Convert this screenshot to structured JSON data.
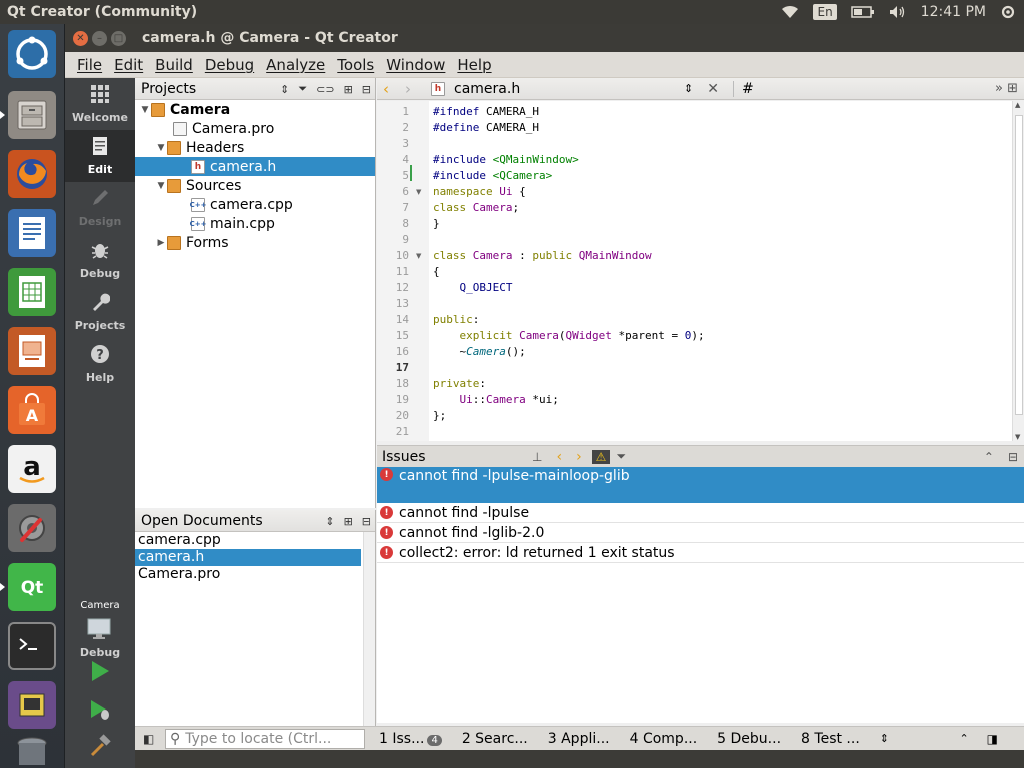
{
  "top_panel": {
    "title": "Qt Creator (Community)",
    "language": "En",
    "clock": "12:41 PM"
  },
  "launcher": {
    "items": [
      "ubuntu-dash",
      "files",
      "firefox",
      "libreoffice-writer",
      "libreoffice-calc",
      "libreoffice-impress",
      "ubuntu-software",
      "amazon",
      "system-settings",
      "qt-creator",
      "terminal",
      "photo-viewer",
      "trash"
    ]
  },
  "window": {
    "title": "camera.h @ Camera - Qt Creator"
  },
  "menu": [
    "File",
    "Edit",
    "Build",
    "Debug",
    "Analyze",
    "Tools",
    "Window",
    "Help"
  ],
  "modes": [
    {
      "label": "Welcome",
      "icon": "grid-icon",
      "state": "normal"
    },
    {
      "label": "Edit",
      "icon": "document-icon",
      "state": "active"
    },
    {
      "label": "Design",
      "icon": "pencil-icon",
      "state": "disabled"
    },
    {
      "label": "Debug",
      "icon": "bug-icon",
      "state": "normal"
    },
    {
      "label": "Projects",
      "icon": "wrench-icon",
      "state": "normal"
    },
    {
      "label": "Help",
      "icon": "question-icon",
      "state": "normal"
    }
  ],
  "kit": {
    "project": "Camera",
    "config": "Debug"
  },
  "projects_pane": {
    "title": "Projects",
    "tree": [
      {
        "label": "Camera",
        "depth": 0,
        "arrow": "▼",
        "icon": "project",
        "bold": true,
        "selected": false
      },
      {
        "label": "Camera.pro",
        "depth": 1,
        "arrow": "",
        "icon": "project",
        "bold": false,
        "selected": false
      },
      {
        "label": "Headers",
        "depth": 1,
        "arrow": "▼",
        "icon": "folder-h",
        "bold": false,
        "selected": false
      },
      {
        "label": "camera.h",
        "depth": 2,
        "arrow": "",
        "icon": "h",
        "bold": false,
        "selected": true
      },
      {
        "label": "Sources",
        "depth": 1,
        "arrow": "▼",
        "icon": "folder-cpp",
        "bold": false,
        "selected": false
      },
      {
        "label": "camera.cpp",
        "depth": 2,
        "arrow": "",
        "icon": "cpp",
        "bold": false,
        "selected": false
      },
      {
        "label": "main.cpp",
        "depth": 2,
        "arrow": "",
        "icon": "cpp",
        "bold": false,
        "selected": false
      },
      {
        "label": "Forms",
        "depth": 1,
        "arrow": "▶",
        "icon": "folder",
        "bold": false,
        "selected": false
      }
    ]
  },
  "open_documents": {
    "title": "Open Documents",
    "items": [
      {
        "label": "camera.cpp",
        "selected": false
      },
      {
        "label": "camera.h",
        "selected": true
      },
      {
        "label": "Camera.pro",
        "selected": false
      }
    ]
  },
  "editor": {
    "file_name": "camera.h",
    "symbol": "#",
    "current_line": 17,
    "lines": [
      {
        "n": "1",
        "fold": "",
        "html": "<span class=\"pp\">#ifndef</span> CAMERA_H"
      },
      {
        "n": "2",
        "fold": "",
        "html": "<span class=\"pp\">#define</span> CAMERA_H"
      },
      {
        "n": "3",
        "fold": "",
        "html": ""
      },
      {
        "n": "4",
        "fold": "",
        "html": "<span class=\"pp\">#include</span> <span class=\"str\">&lt;QMainWindow&gt;</span>"
      },
      {
        "n": "5",
        "fold": "",
        "html": "<span class=\"pp\">#include</span> <span class=\"str\">&lt;QCamera&gt;</span>"
      },
      {
        "n": "6",
        "fold": "▼",
        "html": "<span class=\"kw\">namespace</span> <span class=\"ty\">Ui</span> {"
      },
      {
        "n": "7",
        "fold": "",
        "html": "<span class=\"kw\">class</span> <span class=\"ty\">Camera</span>;"
      },
      {
        "n": "8",
        "fold": "",
        "html": "}"
      },
      {
        "n": "9",
        "fold": "",
        "html": ""
      },
      {
        "n": "10",
        "fold": "▼",
        "html": "<span class=\"kw\">class</span> <span class=\"ty\">Camera</span> : <span class=\"kw\">public</span> <span class=\"ty\">QMainWindow</span>"
      },
      {
        "n": "11",
        "fold": "",
        "html": "{"
      },
      {
        "n": "12",
        "fold": "",
        "html": "    <span class=\"pp\">Q_OBJECT</span>"
      },
      {
        "n": "13",
        "fold": "",
        "html": ""
      },
      {
        "n": "14",
        "fold": "",
        "html": "<span class=\"kw\">public</span>:"
      },
      {
        "n": "15",
        "fold": "",
        "html": "    <span class=\"kw\">explicit</span> <span class=\"ty\">Camera</span>(<span class=\"ty\">QWidget</span> *parent = <span class=\"num\">0</span>);"
      },
      {
        "n": "16",
        "fold": "",
        "html": "    ~<span class=\"it\">Camera</span>();"
      },
      {
        "n": "17",
        "fold": "",
        "html": ""
      },
      {
        "n": "18",
        "fold": "",
        "html": "<span class=\"kw\">private</span>:"
      },
      {
        "n": "19",
        "fold": "",
        "html": "    <span class=\"ty\">Ui</span>::<span class=\"ty\">Camera</span> *ui;"
      },
      {
        "n": "20",
        "fold": "",
        "html": "};"
      },
      {
        "n": "21",
        "fold": "",
        "html": ""
      }
    ]
  },
  "issues": {
    "title": "Issues",
    "items": [
      {
        "text": "cannot find -lpulse-mainloop-glib",
        "selected": true
      },
      {
        "text": "cannot find -lpulse",
        "selected": false
      },
      {
        "text": "cannot find -lglib-2.0",
        "selected": false
      },
      {
        "text": "collect2: error: ld returned 1 exit status",
        "selected": false
      }
    ]
  },
  "bottom_bar": {
    "locator_placeholder": "Type to locate (Ctrl...",
    "tabs": [
      {
        "label": "1 Iss...",
        "badge": "4"
      },
      {
        "label": "2 Searc...",
        "badge": ""
      },
      {
        "label": "3 Appli...",
        "badge": ""
      },
      {
        "label": "4 Comp...",
        "badge": ""
      },
      {
        "label": "5 Debu...",
        "badge": ""
      },
      {
        "label": "8 Test ...",
        "badge": ""
      }
    ]
  },
  "colors": {
    "selection": "#308cc6",
    "panel": "#3b3a36",
    "mode_bar": "#404244",
    "error": "#d93a3a"
  }
}
